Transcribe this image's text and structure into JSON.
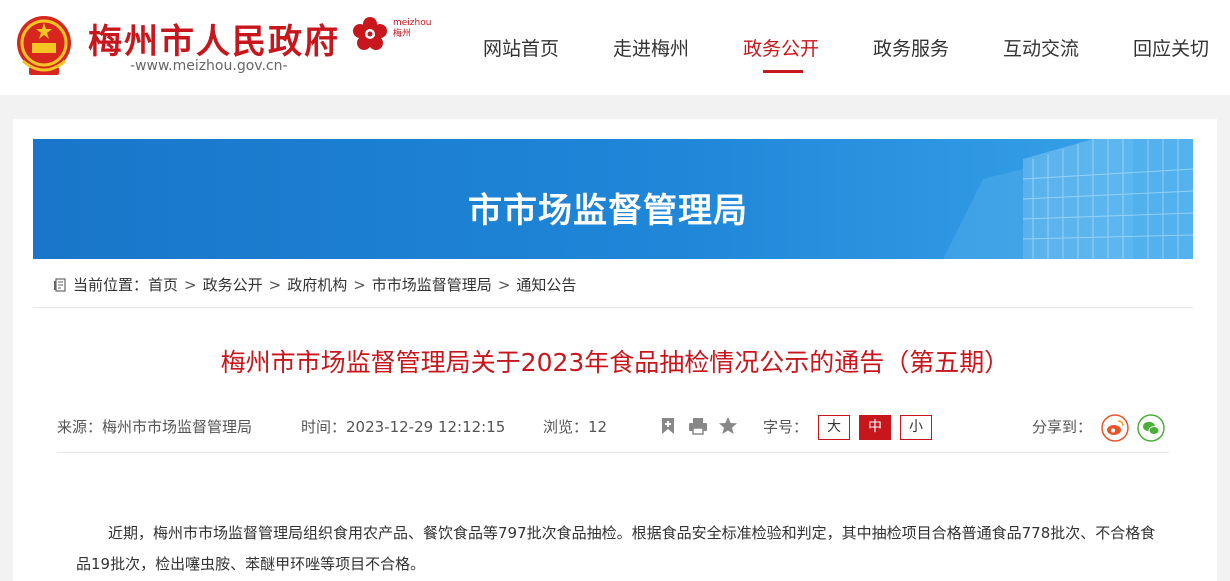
{
  "header": {
    "site_title": "梅州市人民政府",
    "site_url": "-www.meizhou.gov.cn-",
    "city_logo_text_en": "meizhou",
    "city_logo_text_cn": "梅州",
    "nav": [
      "网站首页",
      "走进梅州",
      "政务公开",
      "政务服务",
      "互动交流",
      "回应关切"
    ],
    "active_nav": "政务公开",
    "brand_color": "#c8161d"
  },
  "banner": {
    "title": "市市场监督管理局"
  },
  "breadcrumb": {
    "prefix": "当前位置：",
    "items": [
      "首页",
      "政务公开",
      "政府机构",
      "市市场监督管理局",
      "通知公告"
    ],
    "separator": ">"
  },
  "article": {
    "title": "梅州市市场监督管理局关于2023年食品抽检情况公示的通告（第五期）",
    "source": "来源：梅州市市场监督管理局",
    "time": "时间：2023-12-29 12:12:15",
    "views": "浏览：12",
    "font_size_label": "字号：",
    "font_sizes": [
      "大",
      "中",
      "小"
    ],
    "active_font_size": "中",
    "share_label": "分享到：",
    "body": "近期，梅州市市场监督管理局组织食用农产品、餐饮食品等797批次食品抽检。根据食品安全标准检验和判定，其中抽检项目合格普通食品778批次、不合格食品19批次，检出噻虫胺、苯醚甲环唑等项目不合格。"
  },
  "icons": {
    "emblem": "national-emblem-icon",
    "city_logo": "meizhou-flower-logo",
    "breadcrumb": "location-doc-icon",
    "tools": [
      "bookmark-icon",
      "print-icon",
      "star-icon"
    ],
    "share": [
      "weibo-icon",
      "wechat-icon"
    ]
  }
}
